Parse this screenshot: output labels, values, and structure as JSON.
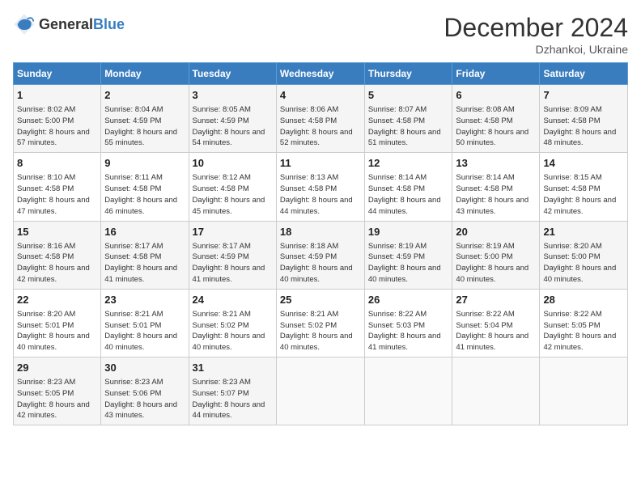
{
  "header": {
    "logo_general": "General",
    "logo_blue": "Blue",
    "month_title": "December 2024",
    "location": "Dzhankoi, Ukraine"
  },
  "days_of_week": [
    "Sunday",
    "Monday",
    "Tuesday",
    "Wednesday",
    "Thursday",
    "Friday",
    "Saturday"
  ],
  "weeks": [
    [
      {
        "day": 1,
        "sunrise": "Sunrise: 8:02 AM",
        "sunset": "Sunset: 5:00 PM",
        "daylight": "Daylight: 8 hours and 57 minutes."
      },
      {
        "day": 2,
        "sunrise": "Sunrise: 8:04 AM",
        "sunset": "Sunset: 4:59 PM",
        "daylight": "Daylight: 8 hours and 55 minutes."
      },
      {
        "day": 3,
        "sunrise": "Sunrise: 8:05 AM",
        "sunset": "Sunset: 4:59 PM",
        "daylight": "Daylight: 8 hours and 54 minutes."
      },
      {
        "day": 4,
        "sunrise": "Sunrise: 8:06 AM",
        "sunset": "Sunset: 4:58 PM",
        "daylight": "Daylight: 8 hours and 52 minutes."
      },
      {
        "day": 5,
        "sunrise": "Sunrise: 8:07 AM",
        "sunset": "Sunset: 4:58 PM",
        "daylight": "Daylight: 8 hours and 51 minutes."
      },
      {
        "day": 6,
        "sunrise": "Sunrise: 8:08 AM",
        "sunset": "Sunset: 4:58 PM",
        "daylight": "Daylight: 8 hours and 50 minutes."
      },
      {
        "day": 7,
        "sunrise": "Sunrise: 8:09 AM",
        "sunset": "Sunset: 4:58 PM",
        "daylight": "Daylight: 8 hours and 48 minutes."
      }
    ],
    [
      {
        "day": 8,
        "sunrise": "Sunrise: 8:10 AM",
        "sunset": "Sunset: 4:58 PM",
        "daylight": "Daylight: 8 hours and 47 minutes."
      },
      {
        "day": 9,
        "sunrise": "Sunrise: 8:11 AM",
        "sunset": "Sunset: 4:58 PM",
        "daylight": "Daylight: 8 hours and 46 minutes."
      },
      {
        "day": 10,
        "sunrise": "Sunrise: 8:12 AM",
        "sunset": "Sunset: 4:58 PM",
        "daylight": "Daylight: 8 hours and 45 minutes."
      },
      {
        "day": 11,
        "sunrise": "Sunrise: 8:13 AM",
        "sunset": "Sunset: 4:58 PM",
        "daylight": "Daylight: 8 hours and 44 minutes."
      },
      {
        "day": 12,
        "sunrise": "Sunrise: 8:14 AM",
        "sunset": "Sunset: 4:58 PM",
        "daylight": "Daylight: 8 hours and 44 minutes."
      },
      {
        "day": 13,
        "sunrise": "Sunrise: 8:14 AM",
        "sunset": "Sunset: 4:58 PM",
        "daylight": "Daylight: 8 hours and 43 minutes."
      },
      {
        "day": 14,
        "sunrise": "Sunrise: 8:15 AM",
        "sunset": "Sunset: 4:58 PM",
        "daylight": "Daylight: 8 hours and 42 minutes."
      }
    ],
    [
      {
        "day": 15,
        "sunrise": "Sunrise: 8:16 AM",
        "sunset": "Sunset: 4:58 PM",
        "daylight": "Daylight: 8 hours and 42 minutes."
      },
      {
        "day": 16,
        "sunrise": "Sunrise: 8:17 AM",
        "sunset": "Sunset: 4:58 PM",
        "daylight": "Daylight: 8 hours and 41 minutes."
      },
      {
        "day": 17,
        "sunrise": "Sunrise: 8:17 AM",
        "sunset": "Sunset: 4:59 PM",
        "daylight": "Daylight: 8 hours and 41 minutes."
      },
      {
        "day": 18,
        "sunrise": "Sunrise: 8:18 AM",
        "sunset": "Sunset: 4:59 PM",
        "daylight": "Daylight: 8 hours and 40 minutes."
      },
      {
        "day": 19,
        "sunrise": "Sunrise: 8:19 AM",
        "sunset": "Sunset: 4:59 PM",
        "daylight": "Daylight: 8 hours and 40 minutes."
      },
      {
        "day": 20,
        "sunrise": "Sunrise: 8:19 AM",
        "sunset": "Sunset: 5:00 PM",
        "daylight": "Daylight: 8 hours and 40 minutes."
      },
      {
        "day": 21,
        "sunrise": "Sunrise: 8:20 AM",
        "sunset": "Sunset: 5:00 PM",
        "daylight": "Daylight: 8 hours and 40 minutes."
      }
    ],
    [
      {
        "day": 22,
        "sunrise": "Sunrise: 8:20 AM",
        "sunset": "Sunset: 5:01 PM",
        "daylight": "Daylight: 8 hours and 40 minutes."
      },
      {
        "day": 23,
        "sunrise": "Sunrise: 8:21 AM",
        "sunset": "Sunset: 5:01 PM",
        "daylight": "Daylight: 8 hours and 40 minutes."
      },
      {
        "day": 24,
        "sunrise": "Sunrise: 8:21 AM",
        "sunset": "Sunset: 5:02 PM",
        "daylight": "Daylight: 8 hours and 40 minutes."
      },
      {
        "day": 25,
        "sunrise": "Sunrise: 8:21 AM",
        "sunset": "Sunset: 5:02 PM",
        "daylight": "Daylight: 8 hours and 40 minutes."
      },
      {
        "day": 26,
        "sunrise": "Sunrise: 8:22 AM",
        "sunset": "Sunset: 5:03 PM",
        "daylight": "Daylight: 8 hours and 41 minutes."
      },
      {
        "day": 27,
        "sunrise": "Sunrise: 8:22 AM",
        "sunset": "Sunset: 5:04 PM",
        "daylight": "Daylight: 8 hours and 41 minutes."
      },
      {
        "day": 28,
        "sunrise": "Sunrise: 8:22 AM",
        "sunset": "Sunset: 5:05 PM",
        "daylight": "Daylight: 8 hours and 42 minutes."
      }
    ],
    [
      {
        "day": 29,
        "sunrise": "Sunrise: 8:23 AM",
        "sunset": "Sunset: 5:05 PM",
        "daylight": "Daylight: 8 hours and 42 minutes."
      },
      {
        "day": 30,
        "sunrise": "Sunrise: 8:23 AM",
        "sunset": "Sunset: 5:06 PM",
        "daylight": "Daylight: 8 hours and 43 minutes."
      },
      {
        "day": 31,
        "sunrise": "Sunrise: 8:23 AM",
        "sunset": "Sunset: 5:07 PM",
        "daylight": "Daylight: 8 hours and 44 minutes."
      },
      null,
      null,
      null,
      null
    ]
  ]
}
